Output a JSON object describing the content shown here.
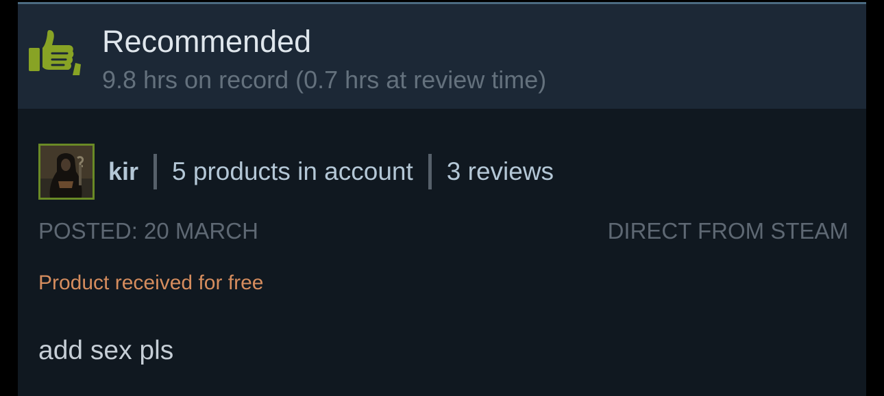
{
  "review": {
    "verdict": "Recommended",
    "hours": "9.8 hrs on record (0.7 hrs at review time)",
    "verdict_icon": "thumbs-up-icon",
    "colors": {
      "accent_green": "#88a325",
      "free_label": "#d68d5e"
    }
  },
  "author": {
    "name": "kir",
    "products": "5 products in account",
    "reviews": "3 reviews",
    "avatar_icon": "hooded-figure-avatar"
  },
  "meta": {
    "posted": "POSTED: 20 MARCH",
    "source": "DIRECT FROM STEAM"
  },
  "notice": {
    "free": "Product received for free"
  },
  "body": {
    "text": "add sex pls"
  }
}
